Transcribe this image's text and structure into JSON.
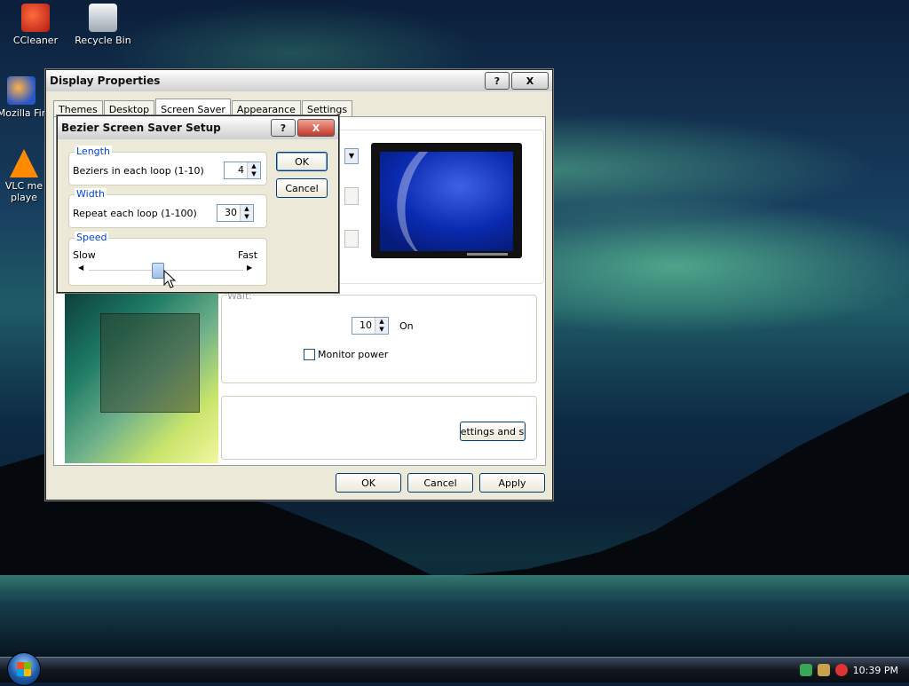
{
  "desktop": {
    "icons": [
      {
        "label": "CCleaner"
      },
      {
        "label": "Recycle Bin"
      },
      {
        "label": "Mozilla Fir"
      },
      {
        "label": "VLC me playe"
      }
    ]
  },
  "display_properties": {
    "title": "Display Properties",
    "help_btn": "?",
    "close_btn": "X",
    "tabs": [
      "Themes",
      "Desktop",
      "Screen Saver",
      "Appearance",
      "Settings"
    ],
    "active_tab": "Screen Saver",
    "wait_label": "Wait:",
    "wait_value": "10",
    "on_label": "On",
    "monitor_power_label": "Monitor power",
    "settings_btn": "settings and sa",
    "ok_btn": "OK",
    "cancel_btn": "Cancel",
    "apply_btn": "Apply"
  },
  "setup_dialog": {
    "title": "Bezier Screen Saver Setup",
    "help_btn": "?",
    "close_btn": "X",
    "length_group": "Length",
    "beziers_label": "Beziers in each loop (1-10)",
    "beziers_value": "4",
    "width_group": "Width",
    "repeat_label": "Repeat each loop (1-100)",
    "repeat_value": "30",
    "speed_group": "Speed",
    "slow_label": "Slow",
    "fast_label": "Fast",
    "speed_level": 0.45,
    "ok_btn": "OK",
    "cancel_btn": "Cancel"
  },
  "taskbar": {
    "clock": "10:39 PM"
  }
}
